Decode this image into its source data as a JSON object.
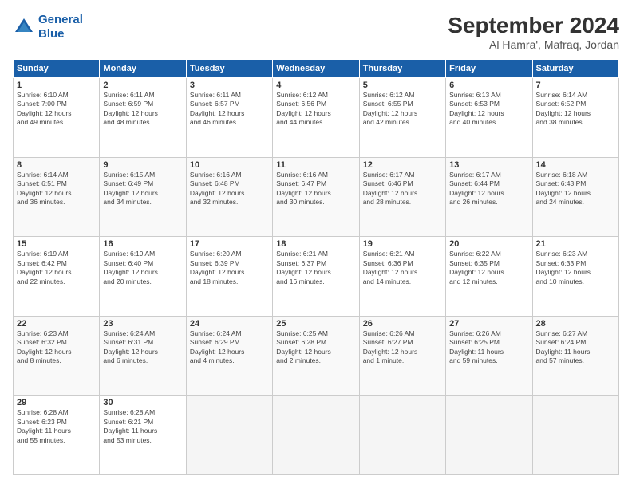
{
  "header": {
    "logo": {
      "line1": "General",
      "line2": "Blue"
    },
    "title": "September 2024",
    "location": "Al Hamra', Mafraq, Jordan"
  },
  "days_of_week": [
    "Sunday",
    "Monday",
    "Tuesday",
    "Wednesday",
    "Thursday",
    "Friday",
    "Saturday"
  ],
  "weeks": [
    [
      {
        "day": "1",
        "info": "Sunrise: 6:10 AM\nSunset: 7:00 PM\nDaylight: 12 hours\nand 49 minutes."
      },
      {
        "day": "2",
        "info": "Sunrise: 6:11 AM\nSunset: 6:59 PM\nDaylight: 12 hours\nand 48 minutes."
      },
      {
        "day": "3",
        "info": "Sunrise: 6:11 AM\nSunset: 6:57 PM\nDaylight: 12 hours\nand 46 minutes."
      },
      {
        "day": "4",
        "info": "Sunrise: 6:12 AM\nSunset: 6:56 PM\nDaylight: 12 hours\nand 44 minutes."
      },
      {
        "day": "5",
        "info": "Sunrise: 6:12 AM\nSunset: 6:55 PM\nDaylight: 12 hours\nand 42 minutes."
      },
      {
        "day": "6",
        "info": "Sunrise: 6:13 AM\nSunset: 6:53 PM\nDaylight: 12 hours\nand 40 minutes."
      },
      {
        "day": "7",
        "info": "Sunrise: 6:14 AM\nSunset: 6:52 PM\nDaylight: 12 hours\nand 38 minutes."
      }
    ],
    [
      {
        "day": "8",
        "info": "Sunrise: 6:14 AM\nSunset: 6:51 PM\nDaylight: 12 hours\nand 36 minutes."
      },
      {
        "day": "9",
        "info": "Sunrise: 6:15 AM\nSunset: 6:49 PM\nDaylight: 12 hours\nand 34 minutes."
      },
      {
        "day": "10",
        "info": "Sunrise: 6:16 AM\nSunset: 6:48 PM\nDaylight: 12 hours\nand 32 minutes."
      },
      {
        "day": "11",
        "info": "Sunrise: 6:16 AM\nSunset: 6:47 PM\nDaylight: 12 hours\nand 30 minutes."
      },
      {
        "day": "12",
        "info": "Sunrise: 6:17 AM\nSunset: 6:46 PM\nDaylight: 12 hours\nand 28 minutes."
      },
      {
        "day": "13",
        "info": "Sunrise: 6:17 AM\nSunset: 6:44 PM\nDaylight: 12 hours\nand 26 minutes."
      },
      {
        "day": "14",
        "info": "Sunrise: 6:18 AM\nSunset: 6:43 PM\nDaylight: 12 hours\nand 24 minutes."
      }
    ],
    [
      {
        "day": "15",
        "info": "Sunrise: 6:19 AM\nSunset: 6:42 PM\nDaylight: 12 hours\nand 22 minutes."
      },
      {
        "day": "16",
        "info": "Sunrise: 6:19 AM\nSunset: 6:40 PM\nDaylight: 12 hours\nand 20 minutes."
      },
      {
        "day": "17",
        "info": "Sunrise: 6:20 AM\nSunset: 6:39 PM\nDaylight: 12 hours\nand 18 minutes."
      },
      {
        "day": "18",
        "info": "Sunrise: 6:21 AM\nSunset: 6:37 PM\nDaylight: 12 hours\nand 16 minutes."
      },
      {
        "day": "19",
        "info": "Sunrise: 6:21 AM\nSunset: 6:36 PM\nDaylight: 12 hours\nand 14 minutes."
      },
      {
        "day": "20",
        "info": "Sunrise: 6:22 AM\nSunset: 6:35 PM\nDaylight: 12 hours\nand 12 minutes."
      },
      {
        "day": "21",
        "info": "Sunrise: 6:23 AM\nSunset: 6:33 PM\nDaylight: 12 hours\nand 10 minutes."
      }
    ],
    [
      {
        "day": "22",
        "info": "Sunrise: 6:23 AM\nSunset: 6:32 PM\nDaylight: 12 hours\nand 8 minutes."
      },
      {
        "day": "23",
        "info": "Sunrise: 6:24 AM\nSunset: 6:31 PM\nDaylight: 12 hours\nand 6 minutes."
      },
      {
        "day": "24",
        "info": "Sunrise: 6:24 AM\nSunset: 6:29 PM\nDaylight: 12 hours\nand 4 minutes."
      },
      {
        "day": "25",
        "info": "Sunrise: 6:25 AM\nSunset: 6:28 PM\nDaylight: 12 hours\nand 2 minutes."
      },
      {
        "day": "26",
        "info": "Sunrise: 6:26 AM\nSunset: 6:27 PM\nDaylight: 12 hours\nand 1 minute."
      },
      {
        "day": "27",
        "info": "Sunrise: 6:26 AM\nSunset: 6:25 PM\nDaylight: 11 hours\nand 59 minutes."
      },
      {
        "day": "28",
        "info": "Sunrise: 6:27 AM\nSunset: 6:24 PM\nDaylight: 11 hours\nand 57 minutes."
      }
    ],
    [
      {
        "day": "29",
        "info": "Sunrise: 6:28 AM\nSunset: 6:23 PM\nDaylight: 11 hours\nand 55 minutes."
      },
      {
        "day": "30",
        "info": "Sunrise: 6:28 AM\nSunset: 6:21 PM\nDaylight: 11 hours\nand 53 minutes."
      },
      {
        "day": "",
        "info": ""
      },
      {
        "day": "",
        "info": ""
      },
      {
        "day": "",
        "info": ""
      },
      {
        "day": "",
        "info": ""
      },
      {
        "day": "",
        "info": ""
      }
    ]
  ]
}
